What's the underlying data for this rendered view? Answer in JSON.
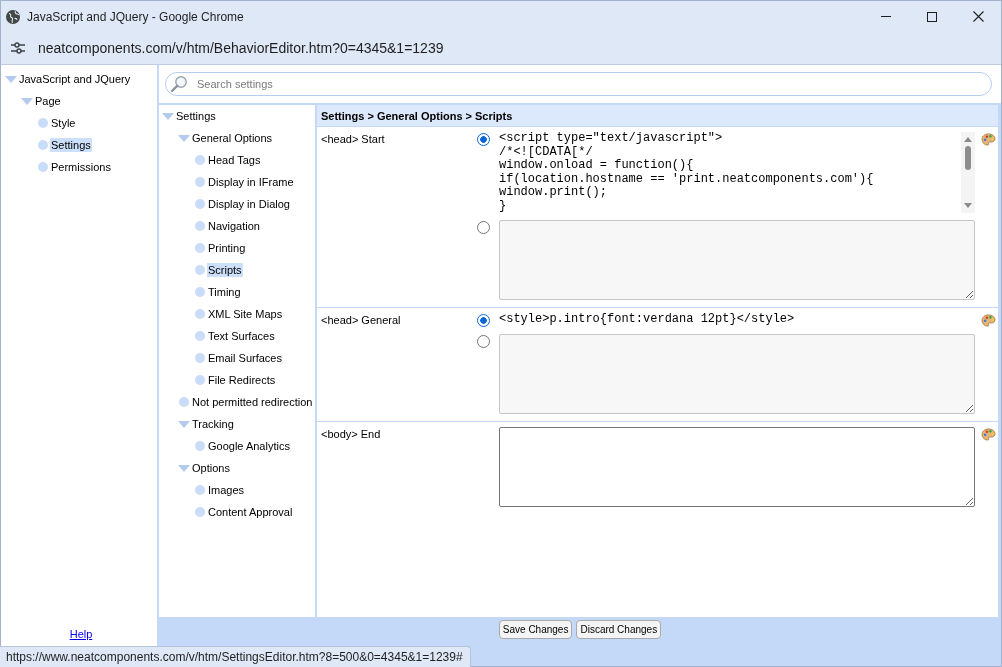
{
  "window": {
    "title": "JavaScript and JQuery - Google Chrome"
  },
  "address_bar": {
    "url": "neatcomponents.com/v/htm/BehaviorEditor.htm?0=4345&1=1239"
  },
  "page_tree": {
    "items": [
      {
        "label": "JavaScript and JQuery",
        "expanded": true,
        "selected": false,
        "children": [
          {
            "label": "Page",
            "expanded": true,
            "selected": false,
            "children": [
              {
                "label": "Style",
                "selected": false
              },
              {
                "label": "Settings",
                "selected": true
              },
              {
                "label": "Permissions",
                "selected": false
              }
            ]
          }
        ]
      }
    ],
    "help_link": "Help"
  },
  "search": {
    "placeholder": "Search settings"
  },
  "settings_tree": {
    "items": [
      {
        "label": "Settings",
        "expanded": true,
        "selected": false,
        "children": [
          {
            "label": "General Options",
            "expanded": true,
            "selected": false,
            "children": [
              {
                "label": "Head Tags",
                "selected": false
              },
              {
                "label": "Display in IFrame",
                "selected": false
              },
              {
                "label": "Display in Dialog",
                "selected": false
              },
              {
                "label": "Navigation",
                "selected": false
              },
              {
                "label": "Printing",
                "selected": false
              },
              {
                "label": "Scripts",
                "selected": true
              },
              {
                "label": "Timing",
                "selected": false
              },
              {
                "label": "XML Site Maps",
                "selected": false
              },
              {
                "label": "Text Surfaces",
                "selected": false
              },
              {
                "label": "Email Surfaces",
                "selected": false
              },
              {
                "label": "File Redirects",
                "selected": false
              }
            ]
          },
          {
            "label": "Not permitted redirection",
            "selected": false
          },
          {
            "label": "Tracking",
            "expanded": true,
            "selected": false,
            "children": [
              {
                "label": "Google Analytics",
                "selected": false
              }
            ]
          },
          {
            "label": "Options",
            "expanded": true,
            "selected": false,
            "children": [
              {
                "label": "Images",
                "selected": false
              },
              {
                "label": "Content Approval",
                "selected": false
              }
            ]
          }
        ]
      }
    ]
  },
  "editor": {
    "breadcrumb": "Settings > General Options > Scripts",
    "rows": [
      {
        "label": "<head> Start",
        "fields": [
          {
            "kind": "code",
            "selected": true,
            "code": "<script type=\"text/javascript\">\n/*<![CDATA[*/\nwindow.onload = function(){\nif(location.hostname == 'print.neatcomponents.com'){\nwindow.print();\n}"
          },
          {
            "kind": "textarea",
            "selected": false,
            "disabled": true
          }
        ]
      },
      {
        "label": "<head> General",
        "fields": [
          {
            "kind": "code",
            "selected": true,
            "code": "<style>p.intro{font:verdana 12pt}</style>"
          },
          {
            "kind": "textarea",
            "selected": false,
            "disabled": true
          }
        ]
      },
      {
        "label": "<body> End",
        "fields": [
          {
            "kind": "textarea",
            "disabled": false
          }
        ]
      }
    ]
  },
  "buttons": [
    "Save Changes",
    "Discard Changes"
  ],
  "status_url": "https://www.neatcomponents.com/v/htm/SettingsEditor.htm?8=500&0=4345&1=1239#"
}
